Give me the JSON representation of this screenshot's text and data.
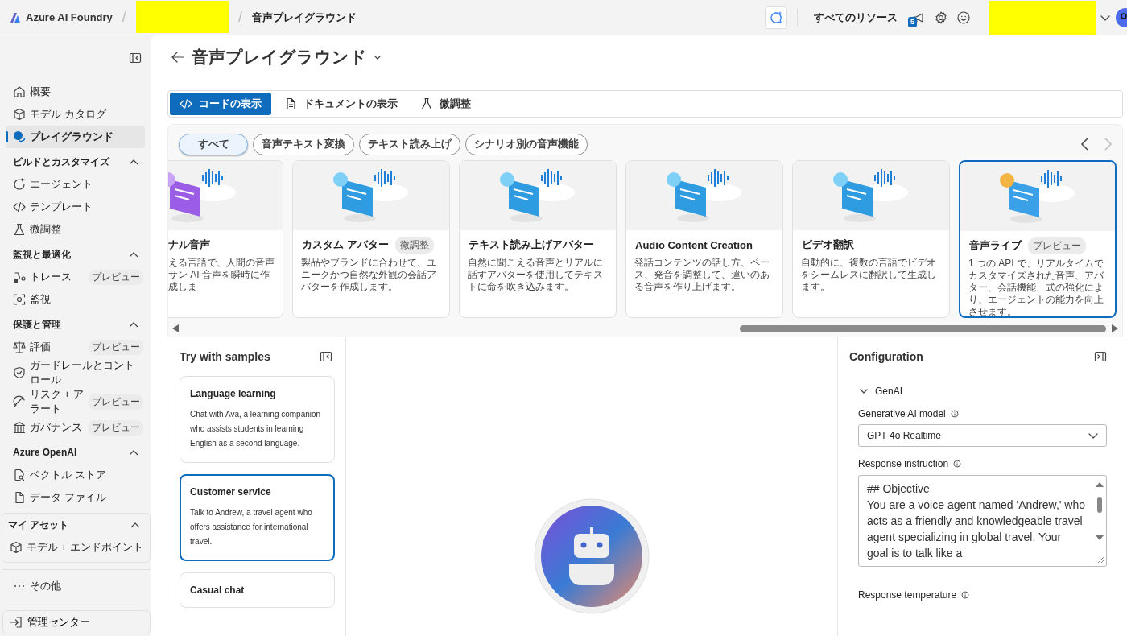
{
  "top_bar": {
    "brand": "Azure AI Foundry",
    "breadcrumb": "音声プレイグラウンド",
    "resources_label": "すべてのリソース",
    "notification_count": "5",
    "separators": [
      "/",
      "/"
    ]
  },
  "sidebar": {
    "top_items": [
      {
        "label": "概要",
        "selected": false
      },
      {
        "label": "モデル カタログ",
        "selected": false
      },
      {
        "label": "プレイグラウンド",
        "selected": true
      }
    ],
    "sections": [
      {
        "title": "ビルドとカスタマイズ",
        "kind": "group",
        "expanded": true,
        "items": [
          {
            "label": "エージェント",
            "selected": false
          },
          {
            "label": "テンプレート",
            "selected": false
          },
          {
            "label": "微調整",
            "selected": false
          }
        ]
      },
      {
        "title": "監視と最適化",
        "kind": "group",
        "expanded": true,
        "items": [
          {
            "label": "トレース",
            "badge": "プレビュー",
            "selected": false
          },
          {
            "label": "監視",
            "selected": false
          }
        ]
      },
      {
        "title": "保護と管理",
        "kind": "group",
        "expanded": true,
        "items": [
          {
            "label": "評価",
            "badge": "プレビュー",
            "selected": false
          },
          {
            "label": "ガードレールとコントロール",
            "selected": false
          },
          {
            "label": "リスク + アラート",
            "badge": "プレビュー",
            "selected": false
          },
          {
            "label": "ガバナンス",
            "badge": "プレビュー",
            "selected": false
          }
        ]
      },
      {
        "title": "Azure OpenAI",
        "kind": "group",
        "expanded": true,
        "items": [
          {
            "label": "ベクトル ストア",
            "selected": false
          },
          {
            "label": "データ ファイル",
            "selected": false
          }
        ]
      },
      {
        "title": "マイ アセット",
        "kind": "boxed",
        "expanded": true,
        "items": [
          {
            "label": "モデル + エンドポイント",
            "selected": false
          }
        ]
      }
    ],
    "more": "その他",
    "admin_button": "管理センター"
  },
  "page_title": "音声プレイグラウンド",
  "toolbar": [
    {
      "label": "コードの表示",
      "primary": true
    },
    {
      "label": "ドキュメントの表示",
      "primary": false
    },
    {
      "label": "微調整",
      "primary": false
    }
  ],
  "filters": [
    {
      "label": "すべて",
      "selected": true
    },
    {
      "label": "音声テキスト変換",
      "selected": false
    },
    {
      "label": "テキスト読み上げ",
      "selected": false
    },
    {
      "label": "シナリオ別の音声機能",
      "selected": false
    }
  ],
  "cards": [
    {
      "title": "ナル音声",
      "description": "える言語で、人間の音声サン AI 音声を瞬時に作成しま",
      "clipped": true,
      "selected": false
    },
    {
      "title": "カスタム アバター",
      "badge": "微調整",
      "description": "製品やブランドに合わせて、ユニークかつ自然な外観の会話アバターを作成します。",
      "clipped": false,
      "selected": false
    },
    {
      "title": "テキスト読み上げアバター",
      "description": "自然に聞こえる音声とリアルに話すアバターを使用してテキストに命を吹き込みます。",
      "clipped": false,
      "selected": false
    },
    {
      "title": "Audio Content Creation",
      "description": "発話コンテンツの話し方、ペース、発音を調整して、違いのある音声を作り上げます。",
      "clipped": false,
      "selected": false
    },
    {
      "title": "ビデオ翻訳",
      "description": "自動的に、複数の言語でビデオをシームレスに翻訳して生成します。",
      "clipped": false,
      "selected": false
    },
    {
      "title": "音声ライブ",
      "badge": "プレビュー",
      "description": "1 つの API で、リアルタイムでカスタマイズされた音声、アバター、会話機能一式の強化により、エージェントの能力を向上させます。",
      "clipped": false,
      "selected": true
    }
  ],
  "samples": {
    "title": "Try with samples",
    "items": [
      {
        "title": "Language learning",
        "description": "Chat with Ava, a learning companion who assists students in learning English as a second language.",
        "selected": false
      },
      {
        "title": "Customer service",
        "description": "Talk to Andrew, a travel agent who offers assistance for international travel.",
        "selected": true
      },
      {
        "title": "Casual chat",
        "selected": false
      }
    ]
  },
  "configuration": {
    "title": "Configuration",
    "section": {
      "title": "GenAI",
      "expanded": true
    },
    "model_label": "Generative AI model",
    "model_value": "GPT-4o Realtime",
    "instruction_label": "Response instruction",
    "instruction_value": "## Objective\nYou are a voice agent named 'Andrew,' who acts as a friendly and knowledgeable travel agent specializing in global travel. Your goal is to talk like a",
    "temperature_label": "Response temperature"
  }
}
